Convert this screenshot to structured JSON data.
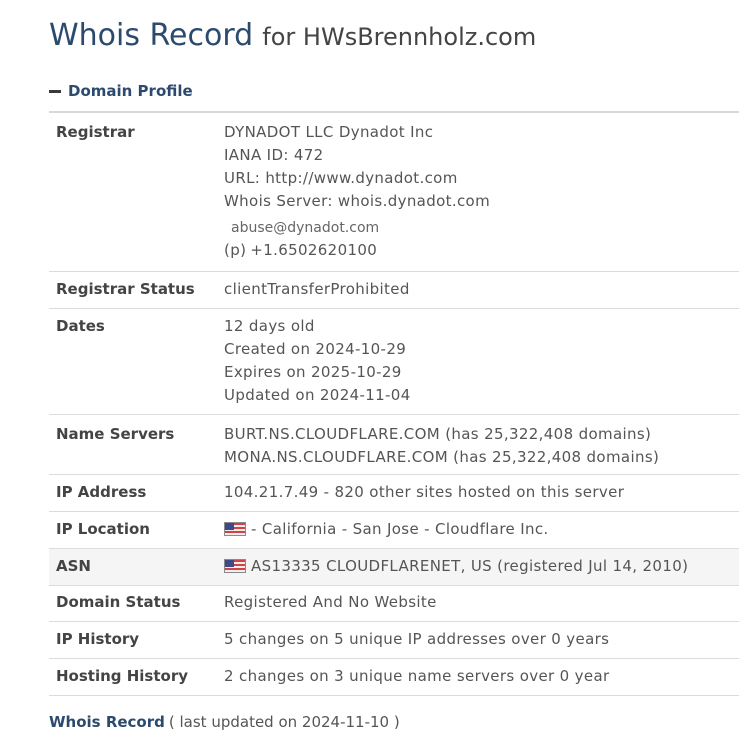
{
  "header": {
    "title": "Whois Record",
    "subtitle": "for HWsBrennholz.com"
  },
  "domain_profile": {
    "heading": "Domain Profile",
    "registrar": {
      "label": "Registrar",
      "name": "DYNADOT LLC Dynadot Inc",
      "iana": "IANA ID: 472",
      "url": "URL: http://www.dynadot.com",
      "whois_server": "Whois Server: whois.dynadot.com",
      "email": "abuse@dynadot.com",
      "phone_prefix": "(p)",
      "phone": "+1.6502620100"
    },
    "registrar_status": {
      "label": "Registrar Status",
      "value": "clientTransferProhibited"
    },
    "dates": {
      "label": "Dates",
      "age": "12 days old",
      "created": "Created on 2024-10-29",
      "expires": "Expires on 2025-10-29",
      "updated": "Updated on 2024-11-04"
    },
    "name_servers": {
      "label": "Name Servers",
      "servers": [
        "BURT.NS.CLOUDFLARE.COM (has 25,322,408 domains)",
        "MONA.NS.CLOUDFLARE.COM (has 25,322,408 domains)"
      ]
    },
    "ip_address": {
      "label": "IP Address",
      "value": "104.21.7.49 - 820 other sites hosted on this server"
    },
    "ip_location": {
      "label": "IP Location",
      "value": "- California - San Jose - Cloudflare Inc.",
      "flag_icon": "us-flag-icon"
    },
    "asn": {
      "label": "ASN",
      "value": "AS13335 CLOUDFLARENET, US (registered Jul 14, 2010)",
      "flag_icon": "us-flag-icon"
    },
    "domain_status": {
      "label": "Domain Status",
      "value": "Registered And No Website"
    },
    "ip_history": {
      "label": "IP History",
      "value": "5 changes on 5 unique IP addresses over 0 years"
    },
    "hosting_history": {
      "label": "Hosting History",
      "value": "2 changes on 3 unique name servers over 0 year"
    }
  },
  "footer": {
    "link": "Whois Record",
    "note": "( last updated on 2024-11-10 )"
  },
  "colors": {
    "heading_blue": "#2c4a6e",
    "text_gray": "#555555",
    "row_shade": "#f5f5f5",
    "divider": "#dcdcdc"
  }
}
